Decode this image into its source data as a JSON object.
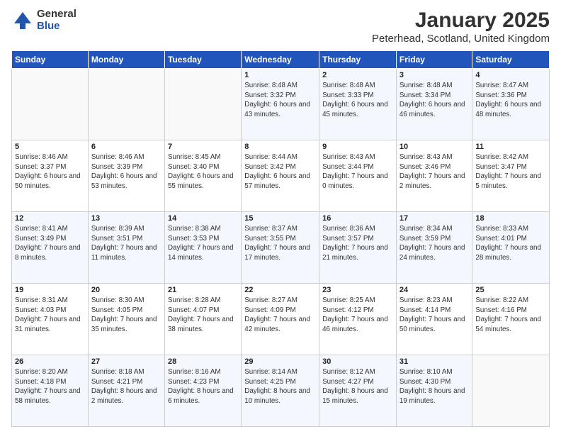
{
  "logo": {
    "general": "General",
    "blue": "Blue"
  },
  "title": "January 2025",
  "subtitle": "Peterhead, Scotland, United Kingdom",
  "days_of_week": [
    "Sunday",
    "Monday",
    "Tuesday",
    "Wednesday",
    "Thursday",
    "Friday",
    "Saturday"
  ],
  "weeks": [
    [
      {
        "day": "",
        "info": ""
      },
      {
        "day": "",
        "info": ""
      },
      {
        "day": "",
        "info": ""
      },
      {
        "day": "1",
        "info": "Sunrise: 8:48 AM\nSunset: 3:32 PM\nDaylight: 6 hours and 43 minutes."
      },
      {
        "day": "2",
        "info": "Sunrise: 8:48 AM\nSunset: 3:33 PM\nDaylight: 6 hours and 45 minutes."
      },
      {
        "day": "3",
        "info": "Sunrise: 8:48 AM\nSunset: 3:34 PM\nDaylight: 6 hours and 46 minutes."
      },
      {
        "day": "4",
        "info": "Sunrise: 8:47 AM\nSunset: 3:36 PM\nDaylight: 6 hours and 48 minutes."
      }
    ],
    [
      {
        "day": "5",
        "info": "Sunrise: 8:46 AM\nSunset: 3:37 PM\nDaylight: 6 hours and 50 minutes."
      },
      {
        "day": "6",
        "info": "Sunrise: 8:46 AM\nSunset: 3:39 PM\nDaylight: 6 hours and 53 minutes."
      },
      {
        "day": "7",
        "info": "Sunrise: 8:45 AM\nSunset: 3:40 PM\nDaylight: 6 hours and 55 minutes."
      },
      {
        "day": "8",
        "info": "Sunrise: 8:44 AM\nSunset: 3:42 PM\nDaylight: 6 hours and 57 minutes."
      },
      {
        "day": "9",
        "info": "Sunrise: 8:43 AM\nSunset: 3:44 PM\nDaylight: 7 hours and 0 minutes."
      },
      {
        "day": "10",
        "info": "Sunrise: 8:43 AM\nSunset: 3:46 PM\nDaylight: 7 hours and 2 minutes."
      },
      {
        "day": "11",
        "info": "Sunrise: 8:42 AM\nSunset: 3:47 PM\nDaylight: 7 hours and 5 minutes."
      }
    ],
    [
      {
        "day": "12",
        "info": "Sunrise: 8:41 AM\nSunset: 3:49 PM\nDaylight: 7 hours and 8 minutes."
      },
      {
        "day": "13",
        "info": "Sunrise: 8:39 AM\nSunset: 3:51 PM\nDaylight: 7 hours and 11 minutes."
      },
      {
        "day": "14",
        "info": "Sunrise: 8:38 AM\nSunset: 3:53 PM\nDaylight: 7 hours and 14 minutes."
      },
      {
        "day": "15",
        "info": "Sunrise: 8:37 AM\nSunset: 3:55 PM\nDaylight: 7 hours and 17 minutes."
      },
      {
        "day": "16",
        "info": "Sunrise: 8:36 AM\nSunset: 3:57 PM\nDaylight: 7 hours and 21 minutes."
      },
      {
        "day": "17",
        "info": "Sunrise: 8:34 AM\nSunset: 3:59 PM\nDaylight: 7 hours and 24 minutes."
      },
      {
        "day": "18",
        "info": "Sunrise: 8:33 AM\nSunset: 4:01 PM\nDaylight: 7 hours and 28 minutes."
      }
    ],
    [
      {
        "day": "19",
        "info": "Sunrise: 8:31 AM\nSunset: 4:03 PM\nDaylight: 7 hours and 31 minutes."
      },
      {
        "day": "20",
        "info": "Sunrise: 8:30 AM\nSunset: 4:05 PM\nDaylight: 7 hours and 35 minutes."
      },
      {
        "day": "21",
        "info": "Sunrise: 8:28 AM\nSunset: 4:07 PM\nDaylight: 7 hours and 38 minutes."
      },
      {
        "day": "22",
        "info": "Sunrise: 8:27 AM\nSunset: 4:09 PM\nDaylight: 7 hours and 42 minutes."
      },
      {
        "day": "23",
        "info": "Sunrise: 8:25 AM\nSunset: 4:12 PM\nDaylight: 7 hours and 46 minutes."
      },
      {
        "day": "24",
        "info": "Sunrise: 8:23 AM\nSunset: 4:14 PM\nDaylight: 7 hours and 50 minutes."
      },
      {
        "day": "25",
        "info": "Sunrise: 8:22 AM\nSunset: 4:16 PM\nDaylight: 7 hours and 54 minutes."
      }
    ],
    [
      {
        "day": "26",
        "info": "Sunrise: 8:20 AM\nSunset: 4:18 PM\nDaylight: 7 hours and 58 minutes."
      },
      {
        "day": "27",
        "info": "Sunrise: 8:18 AM\nSunset: 4:21 PM\nDaylight: 8 hours and 2 minutes."
      },
      {
        "day": "28",
        "info": "Sunrise: 8:16 AM\nSunset: 4:23 PM\nDaylight: 8 hours and 6 minutes."
      },
      {
        "day": "29",
        "info": "Sunrise: 8:14 AM\nSunset: 4:25 PM\nDaylight: 8 hours and 10 minutes."
      },
      {
        "day": "30",
        "info": "Sunrise: 8:12 AM\nSunset: 4:27 PM\nDaylight: 8 hours and 15 minutes."
      },
      {
        "day": "31",
        "info": "Sunrise: 8:10 AM\nSunset: 4:30 PM\nDaylight: 8 hours and 19 minutes."
      },
      {
        "day": "",
        "info": ""
      }
    ]
  ]
}
